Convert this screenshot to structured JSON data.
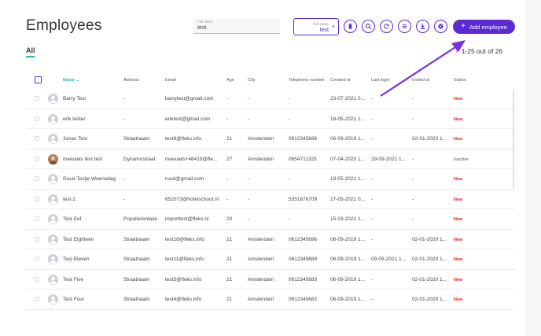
{
  "header": {
    "title": "Employees",
    "fullname_field": {
      "label": "Full name",
      "value": "test"
    },
    "filter_chip": {
      "label": "Full name",
      "value": "test",
      "remove_glyph": "×"
    },
    "toolbar_icons": [
      "trash-icon",
      "search-icon",
      "refresh-icon",
      "filter-list-icon",
      "download-icon",
      "gear-icon"
    ],
    "add_button": {
      "icon": "+",
      "label": "Add employee"
    }
  },
  "tabs": {
    "all_label": "All"
  },
  "pager": {
    "prev": "‹",
    "next": "›",
    "text": "1-25 out of 26"
  },
  "table": {
    "columns": {
      "name": "Name",
      "address": "Address",
      "email": "Email",
      "age": "Age",
      "city": "City",
      "phone": "Telephone number",
      "created": "Created at",
      "last_login": "Last login",
      "invited": "Invited at",
      "status": "Status"
    },
    "rows": [
      {
        "name": "Barry Test",
        "address": "-",
        "email": "barrytest@gmail.com",
        "age": "-",
        "city": "-",
        "phone": "-",
        "created": "23-07-2021 0...",
        "last_login": "-",
        "invited": "-",
        "status": "New"
      },
      {
        "name": "erik tester",
        "address": "-",
        "email": "eriktest@gmail.com",
        "age": "-",
        "city": "-",
        "phone": "-",
        "created": "18-05-2021 1...",
        "last_login": "-",
        "invited": "-",
        "status": "New"
      },
      {
        "name": "Jonas Test",
        "address": "Straatnaam",
        "email": "test8@fleks.info",
        "age": "21",
        "city": "Amsterdam",
        "phone": "0612345686",
        "created": "06-09-2019 1...",
        "last_login": "-",
        "invited": "02-01-2020 1...",
        "status": "New"
      },
      {
        "name": "meeuwis test test",
        "address": "Dynamostraat",
        "email": "meeuwis+48419@fle...",
        "age": "27",
        "city": "Amsterdam",
        "phone": "0654711325",
        "created": "07-04-2020 1...",
        "last_login": "29-09-2021 1...",
        "invited": "-",
        "status": "Inactive",
        "photo": true
      },
      {
        "name": "Ruud Testje Woensdag",
        "address": "-",
        "email": "ruud@gmail.com",
        "age": "-",
        "city": "-",
        "phone": "-",
        "created": "19-05-2021 1...",
        "last_login": "-",
        "invited": "-",
        "status": "New"
      },
      {
        "name": "test 2",
        "address": "-",
        "email": "652073@hotelschool.nl",
        "age": "-",
        "city": "-",
        "phone": "5351676709",
        "created": "27-05-2021 0...",
        "last_login": "-",
        "invited": "-",
        "status": "New"
      },
      {
        "name": "Test Eef",
        "address": "Populierenlaan",
        "email": "importtest@fleks.nl",
        "age": "20",
        "city": "-",
        "phone": "-",
        "created": "15-03-2021 1...",
        "last_login": "-",
        "invited": "-",
        "status": "New"
      },
      {
        "name": "Test Eighteen",
        "address": "Straatnaam",
        "email": "test18@fleks.info",
        "age": "21",
        "city": "Amsterdam",
        "phone": "0612345696",
        "created": "06-09-2019 1...",
        "last_login": "-",
        "invited": "02-01-2020 1...",
        "status": "New"
      },
      {
        "name": "Test Eleven",
        "address": "Straatnaam",
        "email": "test11@fleks.info",
        "age": "21",
        "city": "Amsterdam",
        "phone": "0612345689",
        "created": "06-09-2019 1...",
        "last_login": "09-09-2021 1...",
        "invited": "02-01-2020 1...",
        "status": "New"
      },
      {
        "name": "Test Five",
        "address": "Straatnaam",
        "email": "test5@fleks.info",
        "age": "21",
        "city": "Amsterdam",
        "phone": "0612345683",
        "created": "06-09-2019 1...",
        "last_login": "-",
        "invited": "02-01-2020 1...",
        "status": "New"
      },
      {
        "name": "Test Four",
        "address": "Straatnaam",
        "email": "test4@fleks.info",
        "age": "21",
        "city": "Amsterdam",
        "phone": "0612345682",
        "created": "06-09-2019 1...",
        "last_login": "-",
        "invited": "02-01-2020 1...",
        "status": "New"
      }
    ]
  },
  "colors": {
    "accent": "#5a2bd5",
    "teal": "#2ab5a5",
    "status_new": "#e0241f"
  }
}
